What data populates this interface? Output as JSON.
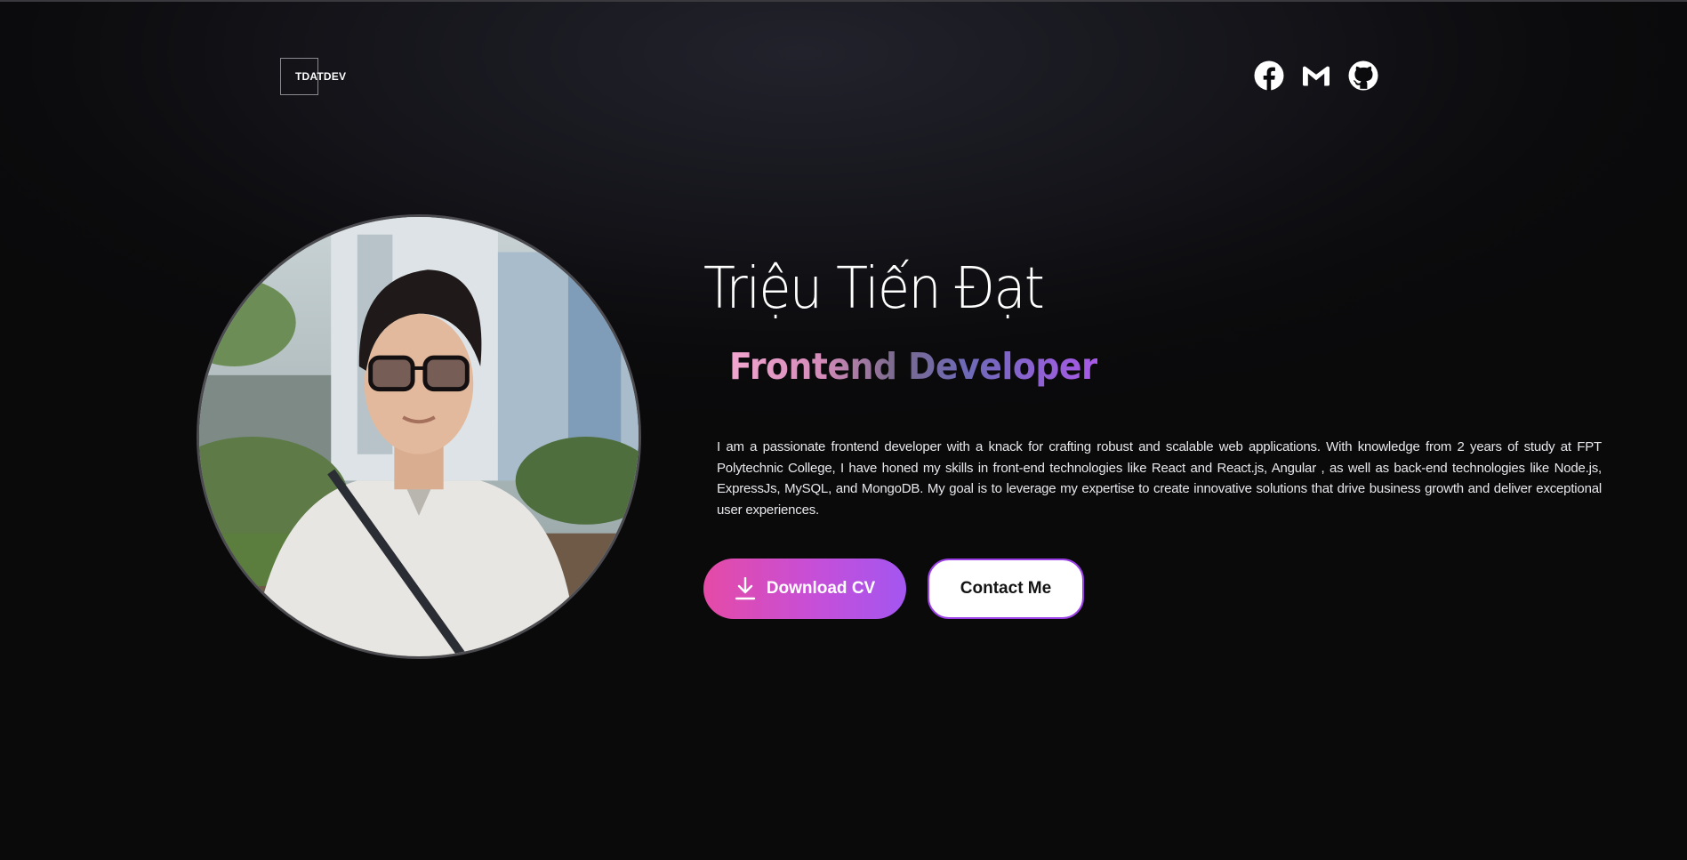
{
  "header": {
    "logo_text": "TDATDEV",
    "socials": [
      {
        "icon": "facebook-icon"
      },
      {
        "icon": "gmail-icon"
      },
      {
        "icon": "github-icon"
      }
    ]
  },
  "hero": {
    "name": "Triệu Tiến Đạt",
    "role": "Frontend Developer",
    "bio": "I am a passionate frontend developer with a knack for crafting robust and scalable web applications. With knowledge from 2 years of study at FPT Polytechnic College, I have honed my skills in front-end technologies like React and React.js, Angular , as well as back-end technologies like Node.js, ExpressJs, MySQL, and MongoDB. My goal is to leverage my expertise to create innovative solutions that drive business growth and deliver exceptional user experiences.",
    "download_label": "Download CV",
    "contact_label": "Contact Me"
  },
  "colors": {
    "background": "#0b0b0d",
    "accent_pink": "#e54aa6",
    "accent_purple": "#a356f0"
  }
}
